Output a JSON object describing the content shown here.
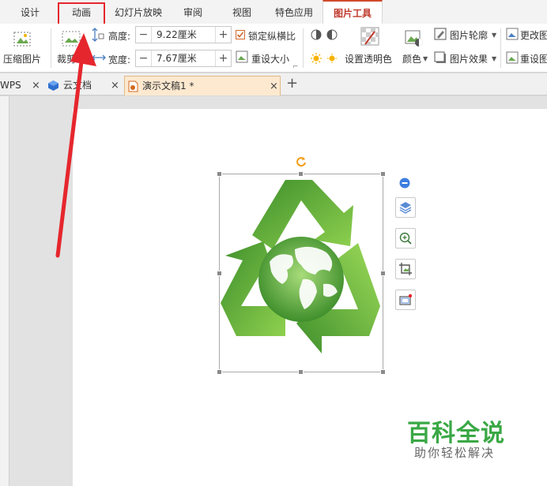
{
  "menu": {
    "tabs": [
      {
        "label": "设计"
      },
      {
        "label": "动画"
      },
      {
        "label": "幻灯片放映"
      },
      {
        "label": "审阅"
      },
      {
        "label": "视图"
      },
      {
        "label": "特色应用"
      },
      {
        "label": "图片工具"
      }
    ]
  },
  "ribbon": {
    "compress_label": "压缩图片",
    "crop_label": "裁剪",
    "height_label": "高度:",
    "height_value": "9.22厘米",
    "width_label": "宽度:",
    "width_value": "7.67厘米",
    "lock_ratio_label": "锁定纵横比",
    "reset_size_label": "重设大小",
    "transparent_label": "设置透明色",
    "color_label": "颜色",
    "outline_label": "图片轮廓",
    "effect_label": "图片效果",
    "change_label": "更改图",
    "reset_label": "重设图"
  },
  "doc_tabs": [
    {
      "label": "WPS"
    },
    {
      "label": "云文档"
    },
    {
      "label": "演示文稿1 *"
    }
  ],
  "watermark": {
    "title": "百科全说",
    "subtitle": "助你轻松解决"
  },
  "colors": {
    "accent": "#d04a2a",
    "highlight": "#e6262d",
    "recycle_dark": "#3f8f2c",
    "recycle_light": "#8fd14f",
    "watermark_green": "#3aa845"
  }
}
